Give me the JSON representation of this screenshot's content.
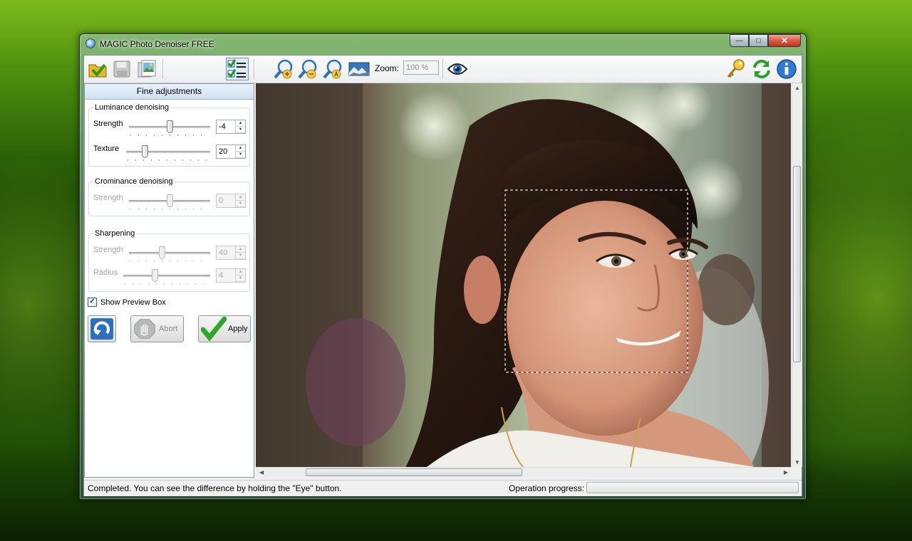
{
  "window": {
    "title": "MAGIC Photo Denoiser FREE"
  },
  "toolbar": {
    "zoom_label": "Zoom:",
    "zoom_value": "100 %",
    "left_icons": [
      "open-folder-icon",
      "save-icon",
      "save-as-icon",
      "fine-adjustments-icon"
    ],
    "zoom_icons": [
      "zoom-in-icon",
      "zoom-out-icon",
      "zoom-fit-icon",
      "fit-image-icon",
      "eye-icon"
    ],
    "right_icons": [
      "key-icon",
      "refresh-icon",
      "info-icon"
    ]
  },
  "panel": {
    "header": "Fine adjustments",
    "luminance": {
      "title": "Luminance denoising",
      "strength_label": "Strength",
      "strength_value": "-4",
      "strength_fraction": 0.5,
      "texture_label": "Texture",
      "texture_value": "20",
      "texture_fraction": 0.2
    },
    "chrominance": {
      "title": "Crominance denoising",
      "strength_label": "Strength",
      "strength_value": "0",
      "strength_fraction": 0.5,
      "enabled": false
    },
    "sharpening": {
      "title": "Sharpening",
      "strength_label": "Strength",
      "strength_value": "40",
      "strength_fraction": 0.4,
      "radius_label": "Radius",
      "radius_value": "4",
      "radius_fraction": 0.35,
      "enabled": false
    },
    "show_preview_box": {
      "label": "Show Preview Box",
      "checked": true
    },
    "buttons": {
      "abort": "Abort",
      "apply": "Apply"
    }
  },
  "status": {
    "message": "Completed. You can see the difference by holding the \"Eye\" button.",
    "progress_label": "Operation progress:",
    "progress": 0
  },
  "colors": {
    "accent": "#3b78c4",
    "apply_check": "#2fa82a",
    "title_close": "#c2341b"
  }
}
